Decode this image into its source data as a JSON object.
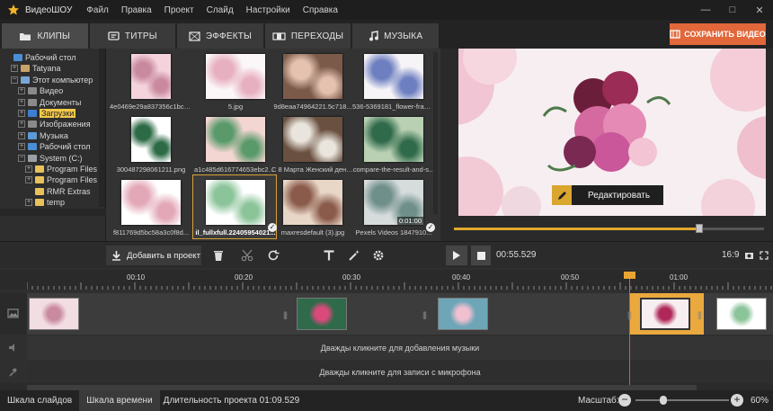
{
  "app": {
    "title": "ВидеоШОУ",
    "logo_icon": "star-logo-icon"
  },
  "menu": [
    "Файл",
    "Правка",
    "Проект",
    "Слайд",
    "Настройки",
    "Справка"
  ],
  "window_controls": [
    "minimize-icon",
    "maximize-icon",
    "close-icon"
  ],
  "tabs": [
    {
      "label": "КЛИПЫ",
      "icon": "folder-icon",
      "active": true
    },
    {
      "label": "ТИТРЫ",
      "icon": "text-icon",
      "active": false
    },
    {
      "label": "ЭФФЕКТЫ",
      "icon": "effects-icon",
      "active": false
    },
    {
      "label": "ПЕРЕХОДЫ",
      "icon": "transitions-icon",
      "active": false
    },
    {
      "label": "МУЗЫКА",
      "icon": "music-icon",
      "active": false
    }
  ],
  "save_button": {
    "label": "СОХРАНИТЬ ВИДЕО"
  },
  "tree": [
    {
      "label": "Рабочий стол",
      "expander": "",
      "icon_color": "#4a8fd6",
      "level": 0
    },
    {
      "label": "Tatyana",
      "expander": "+",
      "icon_color": "#c7a36a",
      "level": 1
    },
    {
      "label": "Этот компьютер",
      "expander": "−",
      "icon_color": "#7aa6d6",
      "level": 1
    },
    {
      "label": "Видео",
      "expander": "+",
      "icon_color": "#8a8a8a",
      "level": 2
    },
    {
      "label": "Документы",
      "expander": "+",
      "icon_color": "#8a8a8a",
      "level": 2
    },
    {
      "label": "Загрузки",
      "expander": "+",
      "icon_color": "#3d7fd1",
      "level": 2,
      "selected": true
    },
    {
      "label": "Изображения",
      "expander": "+",
      "icon_color": "#8a8a8a",
      "level": 2
    },
    {
      "label": "Музыка",
      "expander": "+",
      "icon_color": "#5a9ad8",
      "level": 2
    },
    {
      "label": "Рабочий стол",
      "expander": "+",
      "icon_color": "#4a8fd6",
      "level": 2
    },
    {
      "label": "System (C:)",
      "expander": "−",
      "icon_color": "#9aa0a6",
      "level": 2
    },
    {
      "label": "Program Files",
      "expander": "+",
      "icon_color": "#e8c15a",
      "level": 3
    },
    {
      "label": "Program Files (x",
      "expander": "+",
      "icon_color": "#e8c15a",
      "level": 3
    },
    {
      "label": "RMR Extras",
      "expander": "",
      "icon_color": "#e8c15a",
      "level": 3
    },
    {
      "label": "temp",
      "expander": "+",
      "icon_color": "#e8c15a",
      "level": 3
    }
  ],
  "gallery": [
    {
      "label": "4e0469e29a837356c1bc0...",
      "colors": [
        "#f4d3dc",
        "#c98aa0"
      ],
      "checked": false
    },
    {
      "label": "5.jpg",
      "colors": [
        "#fbf7f8",
        "#e7b0c0"
      ],
      "checked": false
    },
    {
      "label": "9d8eaa74964221.5c718...",
      "colors": [
        "#7b5a4a",
        "#e5c2b0"
      ],
      "checked": false
    },
    {
      "label": "536-5369181_flower-fram...",
      "colors": [
        "#f7f4f7",
        "#6d7fc0"
      ],
      "checked": false
    },
    {
      "label": "300487298061211.png",
      "colors": [
        "#ffffff",
        "#2d6b46"
      ],
      "checked": false
    },
    {
      "label": "a1c485d616774653ebc2d...",
      "colors": [
        "#f3d6d2",
        "#5a9a6a"
      ],
      "checked": false
    },
    {
      "label": "С 8 Марта Женский день...",
      "colors": [
        "#6a5040",
        "#e9e4dc"
      ],
      "checked": false
    },
    {
      "label": "compare-the-result-and-s...",
      "colors": [
        "#b9d0b3",
        "#2f6a4a"
      ],
      "checked": false
    },
    {
      "label": "f811769d5bc58a3c0f8d...",
      "colors": [
        "#ffffff",
        "#e3a8b8"
      ],
      "checked": false
    },
    {
      "label": "il_fullxfull.22405954021...",
      "colors": [
        "#ffffff",
        "#8cc49a"
      ],
      "checked": true,
      "selected": true
    },
    {
      "label": "maxresdefault (3).jpg",
      "colors": [
        "#e8d6c6",
        "#8a5a4a"
      ],
      "checked": false
    },
    {
      "label": "Pexels Videos 1847910...",
      "colors": [
        "#d6dcdc",
        "#6f8f8a"
      ],
      "checked": true,
      "duration": "0:01:00"
    }
  ],
  "preview": {
    "edit_label": "Редактировать",
    "seek": 0.79
  },
  "toolbar": {
    "add_label": "Добавить в проект",
    "icons": [
      "delete-icon",
      "scissors-icon",
      "rotate-icon",
      "text-tool-icon",
      "magic-wand-icon",
      "settings-icon"
    ]
  },
  "player": {
    "time": "00:55.529",
    "aspect": "16:9"
  },
  "ruler": [
    "00:10",
    "00:20",
    "00:30",
    "00:40",
    "00:50",
    "01:00"
  ],
  "timeline": {
    "clips": [
      {
        "colors": [
          "#f2dde3",
          "#c98aa0"
        ]
      },
      {
        "colors": [
          "#2f6a4a",
          "#d94a7a"
        ]
      },
      {
        "colors": [
          "#6ea6b8",
          "#f0c0d0"
        ]
      },
      {
        "colors": [
          "#f6eef0",
          "#b0285a"
        ]
      },
      {
        "colors": [
          "#ffffff",
          "#8cc49a"
        ]
      }
    ],
    "music_hint": "Дважды кликните для добавления музыки",
    "mic_hint": "Дважды кликните для записи с микрофона"
  },
  "status": {
    "tabs": [
      "Шкала слайдов",
      "Шкала времени"
    ],
    "active_tab": 1,
    "duration": "Длительность проекта 01:09.529",
    "zoom_label": "Масштаб:",
    "zoom_value": "60%",
    "zoom_level": 0.3
  }
}
